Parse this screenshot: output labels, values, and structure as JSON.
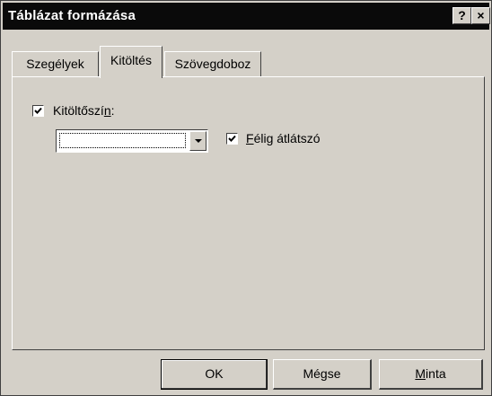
{
  "window": {
    "title": "Táblázat formázása",
    "help_label": "?",
    "close_label": "×"
  },
  "tabs": [
    {
      "label": "Szegélyek",
      "selected": false
    },
    {
      "label": "Kitöltés",
      "selected": true
    },
    {
      "label": "Szövegdoboz",
      "selected": false
    }
  ],
  "fill": {
    "fill_color_checked": true,
    "fill_color_label_pre": "Kitöltőszí",
    "fill_color_label_accel": "n",
    "fill_color_label_post": ":",
    "color_value": "",
    "semi_transparent_checked": true,
    "semi_transparent_label_accel": "F",
    "semi_transparent_label_rest": "élig átlátszó"
  },
  "buttons": {
    "ok": "OK",
    "cancel": "Mégse",
    "sample_accel": "M",
    "sample_rest": "inta"
  },
  "colors": {
    "face": "#d4d0c8",
    "titlebar": "#0a0a0a"
  }
}
